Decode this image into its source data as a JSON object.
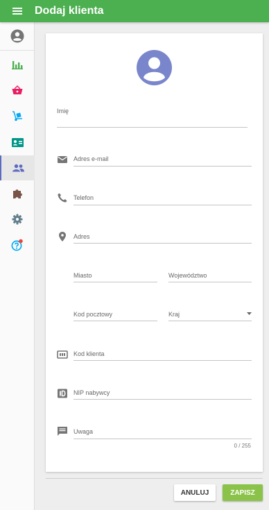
{
  "header": {
    "title": "Dodaj klienta"
  },
  "sidebar": {
    "items": [
      {
        "name": "account",
        "icon": "account-circle-icon",
        "color": "#757575"
      },
      {
        "name": "reports",
        "icon": "bar-chart-icon",
        "color": "#4caf50"
      },
      {
        "name": "sales",
        "icon": "basket-icon",
        "color": "#e91e63"
      },
      {
        "name": "delivery",
        "icon": "hand-truck-icon",
        "color": "#03a9f4"
      },
      {
        "name": "contacts",
        "icon": "contact-card-icon",
        "color": "#009688"
      },
      {
        "name": "customers",
        "icon": "people-icon",
        "color": "#5c6bc0",
        "active": true
      },
      {
        "name": "extensions",
        "icon": "puzzle-icon",
        "color": "#795548"
      },
      {
        "name": "settings",
        "icon": "gear-icon",
        "color": "#607d8b"
      },
      {
        "name": "help",
        "icon": "help-icon",
        "color": "#03a9f4",
        "badge_color": "#f44336"
      }
    ]
  },
  "form": {
    "first_name_label": "Imię",
    "email_label": "Adres e-mail",
    "phone_label": "Telefon",
    "address_label": "Adres",
    "city_label": "Miasto",
    "province_label": "Województwo",
    "postal_code_label": "Kod pocztowy",
    "country_label": "Kraj",
    "customer_code_label": "Kod klienta",
    "nip_label": "NIP nabywcy",
    "note_label": "Uwaga",
    "note_counter": "0 / 255"
  },
  "actions": {
    "cancel_label": "ANULUJ",
    "save_label": "ZAPISZ"
  },
  "colors": {
    "primary": "#4caf50",
    "save": "#8bc34a",
    "avatar": "#7986cb",
    "active_nav": "#5c6bc0"
  }
}
